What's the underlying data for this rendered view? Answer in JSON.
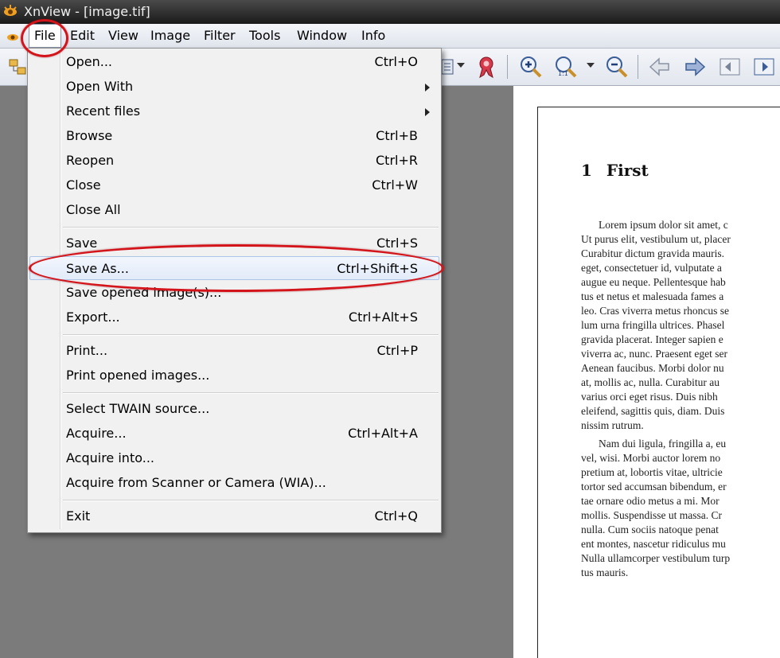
{
  "window": {
    "title": "XnView - [image.tif]",
    "app_icon": "xnview-eye-icon"
  },
  "menubar": {
    "items": [
      {
        "label": "File",
        "active": true
      },
      {
        "label": "Edit"
      },
      {
        "label": "View"
      },
      {
        "label": "Image"
      },
      {
        "label": "Filter"
      },
      {
        "label": "Tools"
      },
      {
        "label": "Window"
      },
      {
        "label": "Info"
      }
    ]
  },
  "toolbar": {
    "icons": [
      "folder-tree-icon",
      "view-list-icon",
      "ribbon-icon",
      "zoom-in-icon",
      "zoom-actual-icon",
      "zoom-out-icon",
      "arrow-left-icon",
      "arrow-right-icon",
      "first-page-icon",
      "next-page-icon"
    ]
  },
  "file_menu": {
    "groups": [
      [
        {
          "label": "Open...",
          "shortcut": "Ctrl+O"
        },
        {
          "label": "Open With",
          "submenu": true
        },
        {
          "label": "Recent files",
          "submenu": true
        },
        {
          "label": "Browse",
          "shortcut": "Ctrl+B"
        },
        {
          "label": "Reopen",
          "shortcut": "Ctrl+R"
        },
        {
          "label": "Close",
          "shortcut": "Ctrl+W"
        },
        {
          "label": "Close All"
        }
      ],
      [
        {
          "label": "Save",
          "shortcut": "Ctrl+S"
        },
        {
          "label": "Save As...",
          "shortcut": "Ctrl+Shift+S",
          "highlighted": true
        },
        {
          "label": "Save opened image(s)..."
        },
        {
          "label": "Export...",
          "shortcut": "Ctrl+Alt+S"
        }
      ],
      [
        {
          "label": "Print...",
          "shortcut": "Ctrl+P"
        },
        {
          "label": "Print opened images..."
        }
      ],
      [
        {
          "label": "Select TWAIN source..."
        },
        {
          "label": "Acquire...",
          "shortcut": "Ctrl+Alt+A"
        },
        {
          "label": "Acquire into..."
        },
        {
          "label": "Acquire from Scanner or Camera (WIA)..."
        }
      ],
      [
        {
          "label": "Exit",
          "shortcut": "Ctrl+Q"
        }
      ]
    ]
  },
  "document": {
    "section_number": "1",
    "section_title": "First",
    "paragraph1": [
      "Lorem ipsum dolor sit amet, c",
      "Ut purus elit, vestibulum ut, placer",
      "Curabitur dictum gravida mauris.",
      "eget, consectetuer id, vulputate a",
      "augue eu neque. Pellentesque hab",
      "tus et netus et malesuada fames a",
      "leo. Cras viverra metus rhoncus se",
      "lum urna fringilla ultrices. Phasel",
      "gravida placerat. Integer sapien e",
      "viverra ac, nunc. Praesent eget ser",
      "Aenean faucibus. Morbi dolor nu",
      "at, mollis ac, nulla. Curabitur au",
      "varius orci eget risus. Duis nibh",
      "eleifend, sagittis quis, diam. Duis",
      "nissim rutrum."
    ],
    "paragraph2": [
      "Nam dui ligula, fringilla a, eu",
      "vel, wisi. Morbi auctor lorem no",
      "pretium at, lobortis vitae, ultricie",
      "tortor sed accumsan bibendum, er",
      "tae ornare odio metus a mi. Mor",
      "mollis. Suspendisse ut massa. Cr",
      "nulla. Cum sociis natoque penat",
      "ent montes, nascetur ridiculus mu",
      "Nulla ullamcorper vestibulum turp",
      "tus mauris."
    ]
  },
  "colors": {
    "annotation": "#d4141b",
    "menu_highlight": "#e2ebf9"
  }
}
